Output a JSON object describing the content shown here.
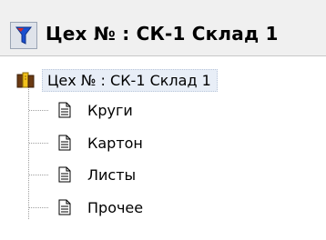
{
  "header": {
    "title": "Цех № : СК-1  Склад 1",
    "filter_icon": "funnel-icon"
  },
  "tree": {
    "root": {
      "label": "Цех № : СК-1  Склад 1",
      "icon": "books-icon"
    },
    "children": [
      {
        "label": "Круги",
        "icon": "document-icon"
      },
      {
        "label": "Картон",
        "icon": "document-icon"
      },
      {
        "label": "Листы",
        "icon": "document-icon"
      },
      {
        "label": "Прочее",
        "icon": "document-icon"
      }
    ]
  },
  "colors": {
    "funnel_blue": "#1a4fcf",
    "funnel_red": "#d42a2a",
    "selection_bg": "#e8eef7"
  }
}
